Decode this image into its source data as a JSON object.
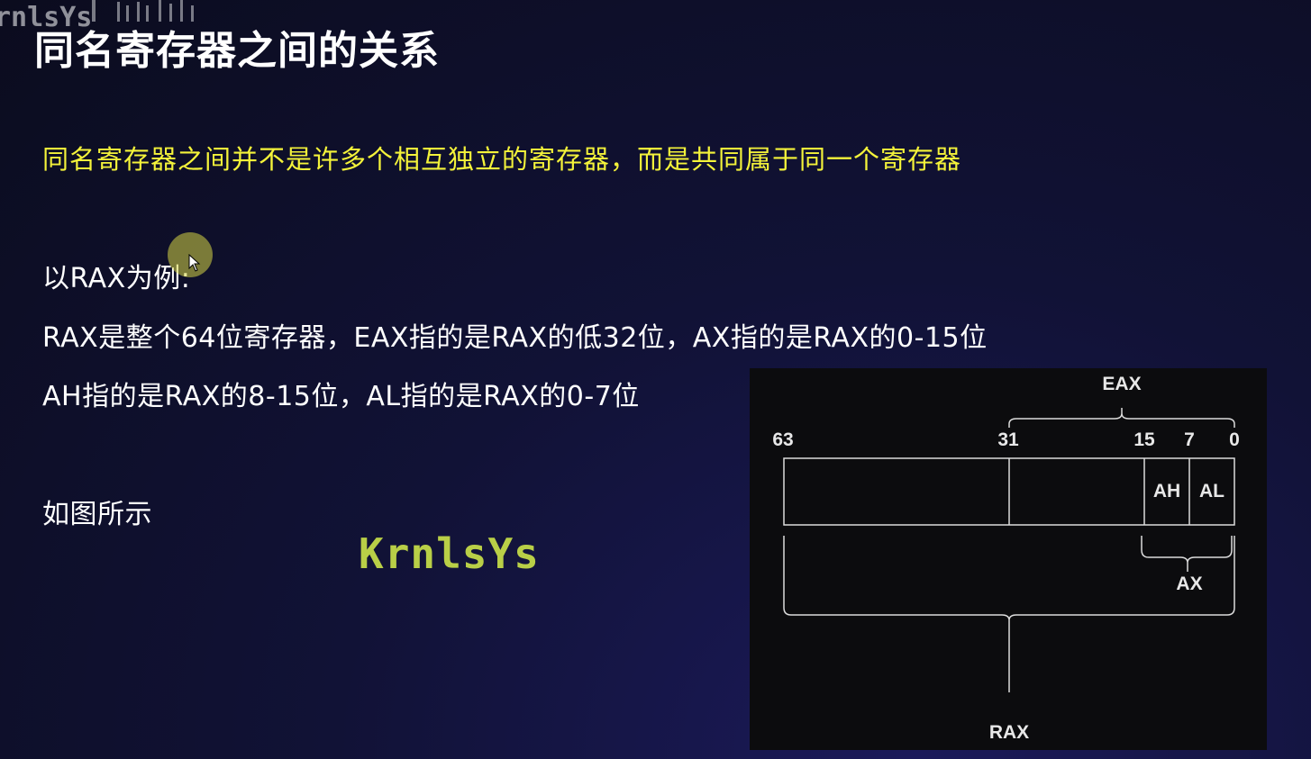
{
  "watermark_corner": "rnlsYs",
  "title": "同名寄存器之间的关系",
  "subtitle": "同名寄存器之间并不是许多个相互独立的寄存器，而是共同属于同一个寄存器",
  "lines": [
    "以RAX为例:",
    "RAX是整个64位寄存器，EAX指的是RAX的低32位，AX指的是RAX的0-15位",
    "AH指的是RAX的8-15位，AL指的是RAX的0-7位",
    "如图所示"
  ],
  "watermark_center": "KrnlsYs",
  "diagram": {
    "bit_labels": [
      "63",
      "31",
      "15",
      "7",
      "0"
    ],
    "cells": [
      "AH",
      "AL"
    ],
    "braces": {
      "eax": "EAX",
      "ax": "AX",
      "rax": "RAX"
    }
  },
  "colors": {
    "subtitle": "#f4f33a",
    "watermark": "#b9cf47",
    "diagram_bg": "#0c0c0e",
    "diagram_line": "#dcdcdc"
  }
}
